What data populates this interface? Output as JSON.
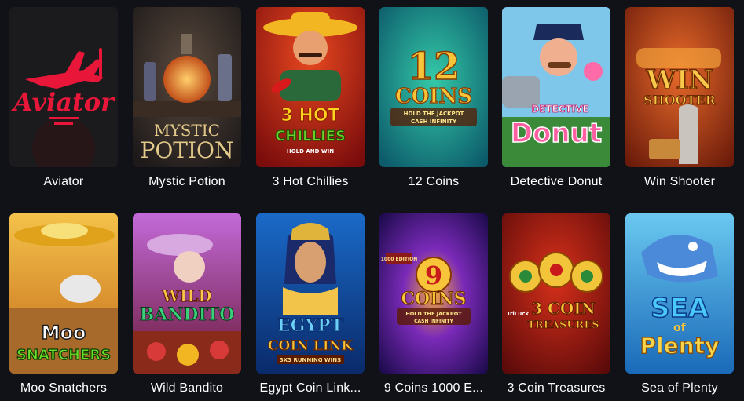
{
  "games": [
    {
      "id": "aviator",
      "title": "Aviator",
      "art": {
        "logo": "Aviator"
      }
    },
    {
      "id": "mystic-potion",
      "title": "Mystic Potion",
      "art": {
        "line1": "MYSTIC",
        "line2": "POTION"
      }
    },
    {
      "id": "3-hot-chillies",
      "title": "3 Hot Chillies",
      "art": {
        "line1": "3 HOT",
        "line2": "CHILLIES",
        "line3": "HOLD AND WIN"
      }
    },
    {
      "id": "12-coins",
      "title": "12 Coins",
      "art": {
        "line1": "12",
        "line2": "COINS",
        "line3": "HOLD THE JACKPOT",
        "line4": "CASH INFINITY"
      }
    },
    {
      "id": "detective-donut",
      "title": "Detective Donut",
      "art": {
        "line1": "DETECTIVE",
        "line2": "Donut"
      }
    },
    {
      "id": "win-shooter",
      "title": "Win Shooter",
      "art": {
        "line1": "WIN",
        "line2": "SHOOTER"
      }
    },
    {
      "id": "moo-snatchers",
      "title": "Moo Snatchers",
      "art": {
        "line1": "Moo",
        "line2": "SNATCHERS"
      }
    },
    {
      "id": "wild-bandito",
      "title": "Wild Bandito",
      "art": {
        "line1": "WILD",
        "line2": "BANDITO"
      }
    },
    {
      "id": "egypt-coin-link",
      "title": "Egypt Coin Link...",
      "art": {
        "line1": "EGYPT",
        "line2": "COIN LINK",
        "line3": "3X3 RUNNING WINS"
      }
    },
    {
      "id": "9-coins-1000",
      "title": "9 Coins 1000 E...",
      "art": {
        "badge": "1000 EDITION",
        "line1": "9",
        "line2": "COINS",
        "line3": "HOLD THE JACKPOT",
        "line4": "CASH INFINITY"
      }
    },
    {
      "id": "3-coin-treasures",
      "title": "3 Coin Treasures",
      "art": {
        "brand": "TriLuck",
        "line1": "3 COIN",
        "line2": "TREASURES"
      }
    },
    {
      "id": "sea-of-plenty",
      "title": "Sea of Plenty",
      "art": {
        "line1": "SEA",
        "line2": "of",
        "line3": "Plenty"
      }
    }
  ]
}
